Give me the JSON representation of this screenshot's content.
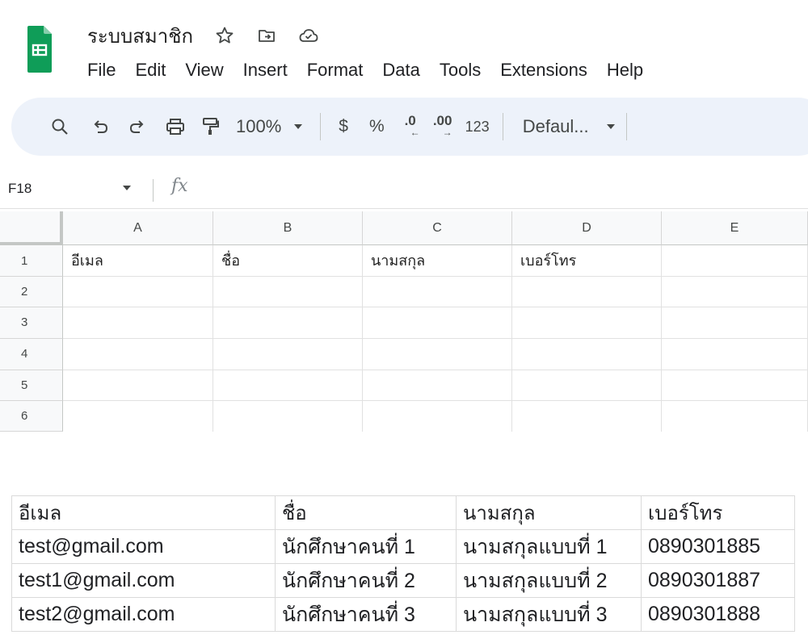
{
  "app": {
    "doc_title": "ระบบสมาชิก",
    "logo_icon": "google-sheets-icon",
    "title_icons": [
      "star-icon",
      "move-to-folder-icon",
      "cloud-saved-icon"
    ]
  },
  "menu": [
    "File",
    "Edit",
    "View",
    "Insert",
    "Format",
    "Data",
    "Tools",
    "Extensions",
    "Help"
  ],
  "toolbar": {
    "zoom": "100%",
    "currency": "$",
    "percent": "%",
    "decrease_decimal": ".0",
    "increase_decimal": ".00",
    "number_format": "123",
    "font": "Defaul...",
    "icons": [
      "search-icon",
      "undo-icon",
      "redo-icon",
      "print-icon",
      "paint-format-icon"
    ]
  },
  "formula_bar": {
    "cell_ref": "F18",
    "fx": "fx"
  },
  "sheet": {
    "columns": [
      "A",
      "B",
      "C",
      "D",
      "E"
    ],
    "rows": [
      "1",
      "2",
      "3",
      "4",
      "5",
      "6"
    ],
    "row1": [
      "อีเมล",
      "ชื่อ",
      "นามสกุล",
      "เบอร์โทร",
      ""
    ]
  },
  "sample_table": {
    "headers": [
      "อีเมล",
      "ชื่อ",
      "นามสกุล",
      "เบอร์โทร"
    ],
    "rows": [
      [
        "test@gmail.com",
        "นักศึกษาคนที่ 1",
        "นามสกุลแบบที่ 1",
        "0890301885"
      ],
      [
        "test1@gmail.com",
        "นักศึกษาคนที่ 2",
        "นามสกุลแบบที่ 2",
        "0890301887"
      ],
      [
        "test2@gmail.com",
        "นักศึกษาคนที่ 3",
        "นามสกุลแบบที่ 3",
        "0890301888"
      ]
    ]
  },
  "colors": {
    "sheets_green": "#0f9d58",
    "toolbar_bg": "#edf2fa",
    "header_bg": "#f8f9fa"
  }
}
